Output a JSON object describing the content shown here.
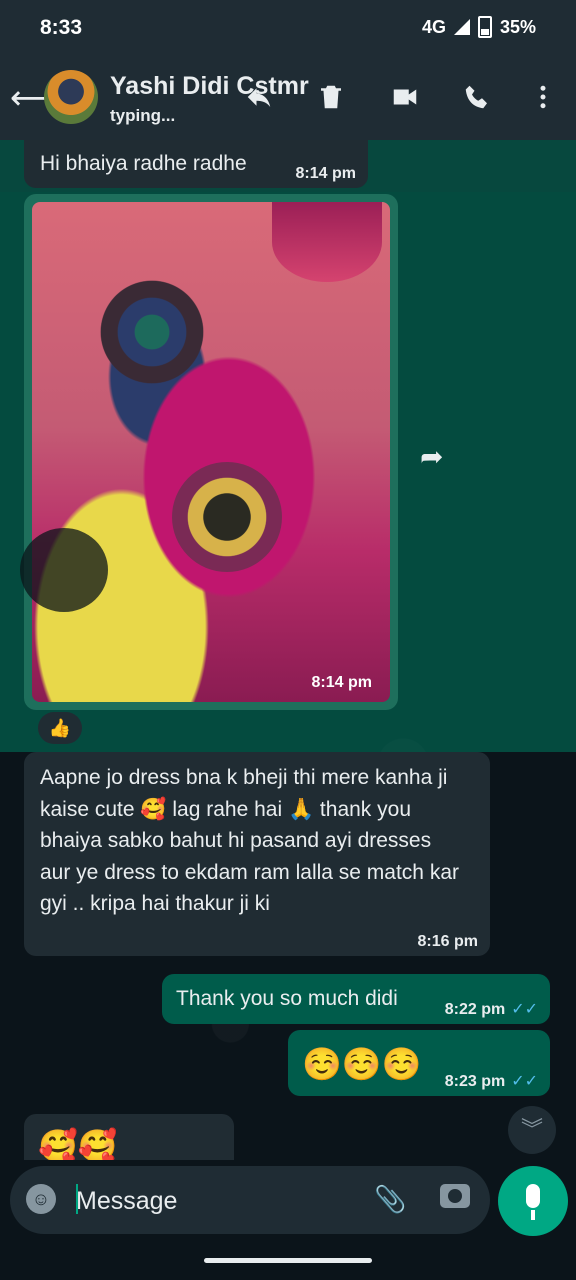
{
  "status_bar": {
    "time": "8:33",
    "network": "4G",
    "battery": "35%"
  },
  "header": {
    "contact_name": "Yashi Didi Cstmr",
    "contact_status": "typing..."
  },
  "messages": [
    {
      "type": "incoming",
      "text": "Hi bhaiya radhe radhe",
      "time": "8:14 pm"
    },
    {
      "type": "incoming-image",
      "time": "8:14 pm",
      "reaction": "👍"
    },
    {
      "type": "incoming",
      "text": "Aapne jo dress bna k bheji thi mere kanha ji kaise cute 🥰 lag rahe hai 🙏 thank you bhaiya sabko bahut hi pasand ayi dresses aur ye dress to ekdam ram lalla se match kar gyi .. kripa hai thakur ji ki",
      "time": "8:16 pm"
    },
    {
      "type": "outgoing",
      "text": "Thank you so much didi",
      "time": "8:22 pm",
      "ticks": "✓✓"
    },
    {
      "type": "outgoing",
      "text": "☺️☺️☺️",
      "time": "8:23 pm",
      "ticks": "✓✓"
    },
    {
      "type": "incoming",
      "text": "🥰🥰"
    }
  ],
  "composer": {
    "placeholder": "Message"
  },
  "colors": {
    "accent": "#00a884",
    "incoming_bubble": "#202c33",
    "outgoing_bubble": "#005c4b",
    "tick": "#53bdeb"
  }
}
